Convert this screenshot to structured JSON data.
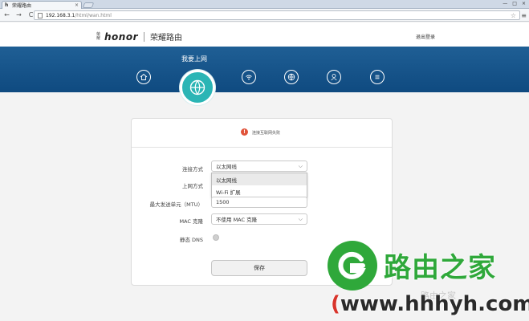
{
  "browser": {
    "tab_title": "荣耀路由",
    "tab_favicon": "h",
    "tab_close": "×",
    "window_controls": [
      "—",
      "□",
      "×"
    ],
    "back": "←",
    "forward": "→",
    "reload": "C",
    "url_host": "192.168.3.1",
    "url_path": "/html/wan.html",
    "star": "☆",
    "menu": "≡"
  },
  "header": {
    "logo_mark": "荣耀",
    "logo_text": "honor",
    "product": "荣耀路由",
    "logout": "退出登录"
  },
  "nav": {
    "title": "我要上网",
    "icons": [
      "home-icon",
      "globe-icon",
      "wifi-icon",
      "network-icon",
      "user-icon",
      "menu-icon"
    ],
    "active": "globe-icon",
    "accent_color": "#2bb5b5",
    "band_color": "#1a5a90"
  },
  "form": {
    "warning_icon": "!",
    "warning_text": "连接互联网失败",
    "connection_mode_label": "连接方式",
    "connection_mode_value": "以太网线",
    "internet_mode_label": "上网方式",
    "dropdown_options": [
      "以太网线",
      "Wi-Fi 扩展"
    ],
    "mtu_label": "最大发送单元（MTU）",
    "mtu_value": "1500",
    "mac_clone_label": "MAC 克隆",
    "mac_clone_value": "不使用 MAC 克隆",
    "static_dns_label": "静态 DNS",
    "save_label": "保存",
    "chevron": "⌵"
  },
  "watermark": {
    "name": "路由之家",
    "url_open": "(",
    "url_text": "www.hhhyh.com",
    "url_close": ")"
  }
}
